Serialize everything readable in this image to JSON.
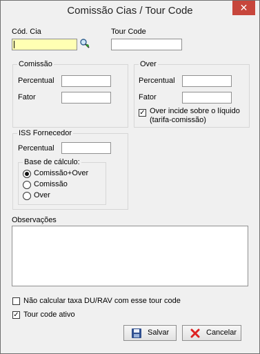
{
  "window": {
    "title": "Comissão Cias / Tour Code",
    "close_glyph": "✕"
  },
  "fields": {
    "cod_cia_label": "Cód. Cia",
    "cod_cia_value": "",
    "tour_code_label": "Tour Code",
    "tour_code_value": ""
  },
  "comissao": {
    "legend": "Comissão",
    "percentual_label": "Percentual",
    "percentual_value": "",
    "fator_label": "Fator",
    "fator_value": ""
  },
  "over": {
    "legend": "Over",
    "percentual_label": "Percentual",
    "percentual_value": "",
    "fator_label": "Fator",
    "fator_value": "",
    "incide_label_line1": "Over incide sobre o líquido",
    "incide_label_line2": "(tarifa-comissão)",
    "incide_checked": true
  },
  "iss": {
    "legend": "ISS Fornecedor",
    "percentual_label": "Percentual",
    "percentual_value": "",
    "base_legend": "Base de cálculo:",
    "options": [
      "Comissão+Over",
      "Comissão",
      "Over"
    ],
    "selected": "Comissão+Over"
  },
  "observacoes": {
    "label": "Observações",
    "value": ""
  },
  "options": {
    "nao_calcular_label": "Não calcular taxa DU/RAV com esse tour code",
    "nao_calcular_checked": false,
    "tour_ativo_label": "Tour code ativo",
    "tour_ativo_checked": true
  },
  "buttons": {
    "salvar": "Salvar",
    "cancelar": "Cancelar"
  },
  "icons": {
    "search": "search-icon",
    "save": "floppy-disk-icon",
    "cancel": "red-x-icon"
  },
  "colors": {
    "close_button": "#c7463c",
    "highlight_input": "#ffffb3"
  }
}
